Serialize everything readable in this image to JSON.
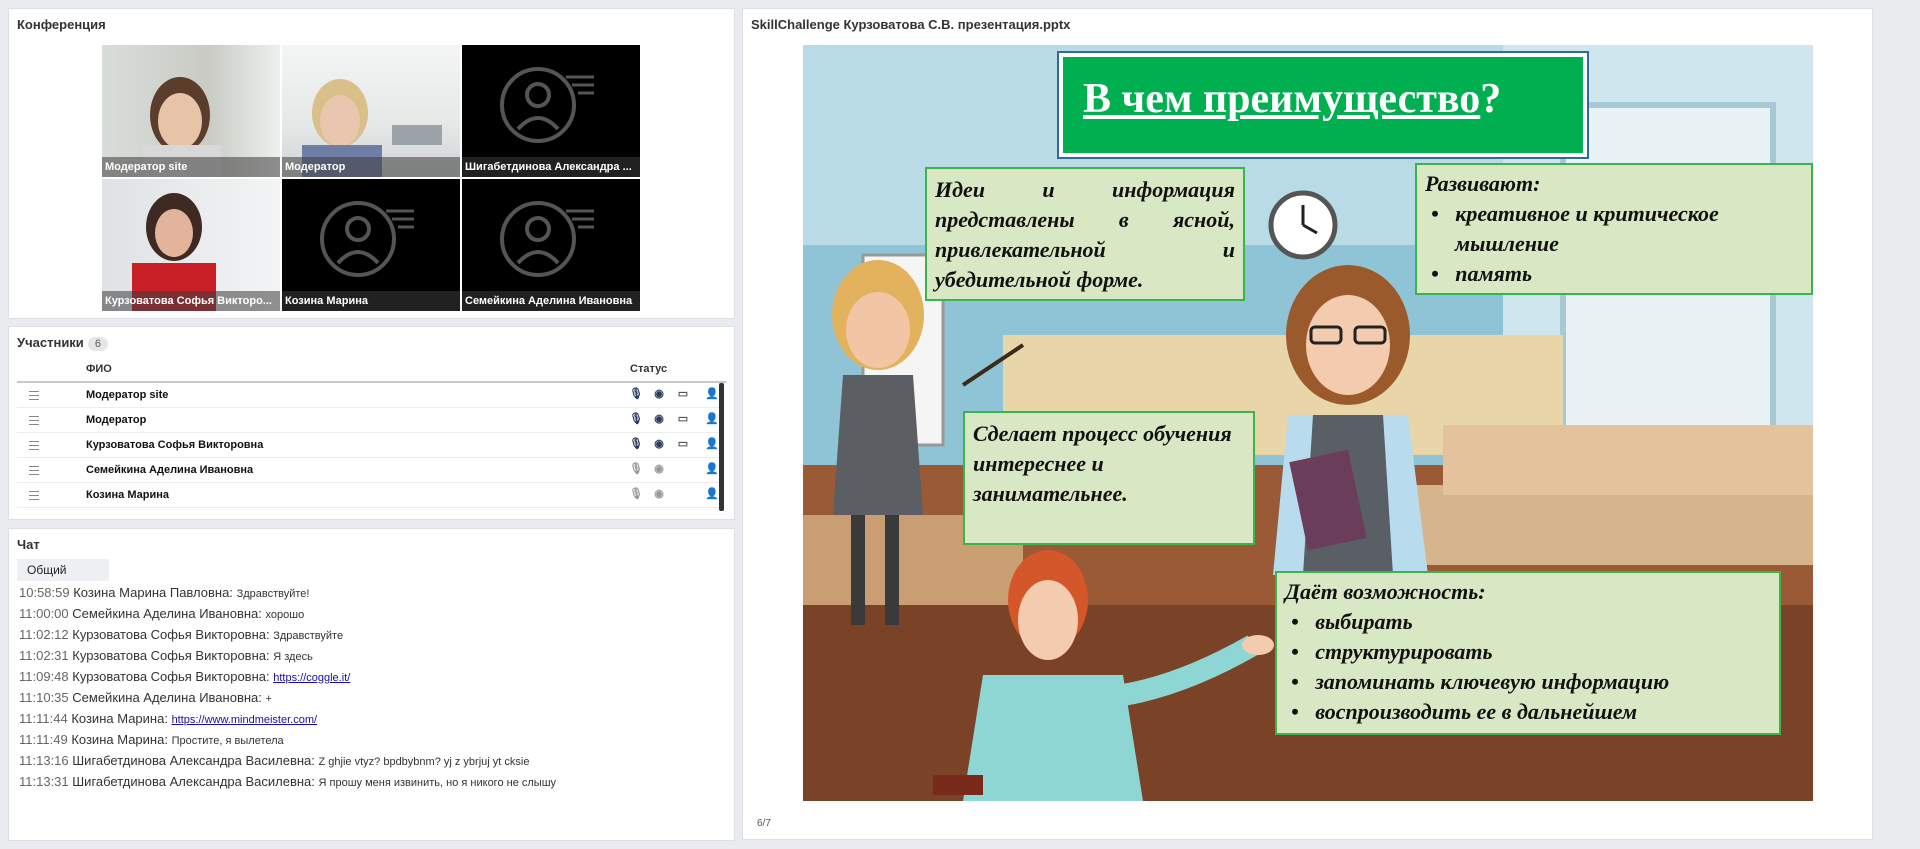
{
  "conference": {
    "title": "Конференция",
    "tiles": [
      {
        "name": "Модератор site",
        "video": true
      },
      {
        "name": "Модератор",
        "video": true
      },
      {
        "name": "Шигабетдинова Александра  ...",
        "video": false
      },
      {
        "name": "Курзоватова Софья   Викторо...",
        "video": true
      },
      {
        "name": "Козина Марина",
        "video": false
      },
      {
        "name": "Семейкина Аделина Ивановна",
        "video": false
      }
    ]
  },
  "participants": {
    "title": "Участники",
    "count": "6",
    "col_name": "ФИО",
    "col_status": "Статус",
    "rows": [
      {
        "name": "Модератор site",
        "mic": "on"
      },
      {
        "name": "Модератор",
        "mic": "on"
      },
      {
        "name": "Курзоватова Софья   Викторовна",
        "mic": "on"
      },
      {
        "name": "Семейкина Аделина Ивановна",
        "mic": "off"
      },
      {
        "name": "Козина Марина",
        "mic": "off"
      }
    ]
  },
  "chat": {
    "title": "Чат",
    "tab": "Общий",
    "messages": [
      {
        "time": "10:58:59",
        "author": "Козина Марина  Павловна:",
        "text": "Здравствуйте!"
      },
      {
        "time": "11:00:00",
        "author": "Семейкина Аделина Ивановна:",
        "text": "хорошо"
      },
      {
        "time": "11:02:12",
        "author": "Курзоватова Софья   Викторовна:",
        "text": "Здравствуйте"
      },
      {
        "time": "11:02:31",
        "author": "Курзоватова Софья   Викторовна:",
        "text": "Я здесь"
      },
      {
        "time": "11:09:48",
        "author": "Курзоватова Софья   Викторовна:",
        "link": "https://coggle.it/"
      },
      {
        "time": "11:10:35",
        "author": "Семейкина Аделина Ивановна:",
        "text": "+"
      },
      {
        "time": "11:11:44",
        "author": "Козина Марина:",
        "link": "https://www.mindmeister.com/"
      },
      {
        "time": "11:11:49",
        "author": "Козина Марина:",
        "text": "Простите, я вылетела"
      },
      {
        "time": "11:13:16",
        "author": "Шигабетдинова Александра  Василевна:",
        "text": "Z ghjie vtyz? bpdbybnm? yj z ybrjuj yt cksie"
      },
      {
        "time": "11:13:31",
        "author": "Шигабетдинова Александра  Василевна:",
        "text": "Я прошу меня извинить, но я никого не слышу"
      }
    ]
  },
  "presentation": {
    "title": "SkillChallenge Курзоватова С.В. презентация.pptx",
    "page": "6/7",
    "slide": {
      "heading": "В чем преимущество",
      "heading_q": "?",
      "box1": "Идеи и информация представлены в ясной, привлекательной и убедительной форме.",
      "box2_title": "Развивают:",
      "box2_items": [
        "креативное и критическое мышление",
        "память"
      ],
      "box3": "Сделает процесс обучения интереснее и занимательнее.",
      "box4_title": "Даёт возможность:",
      "box4_items": [
        "выбирать",
        "структурировать",
        "запоминать ключевую информацию",
        "воспроизводить ее в дальнейшем"
      ]
    }
  },
  "colors": {
    "accent_green": "#00b050",
    "box_green": "#d8e7c4",
    "border_green": "#3cb44b"
  }
}
